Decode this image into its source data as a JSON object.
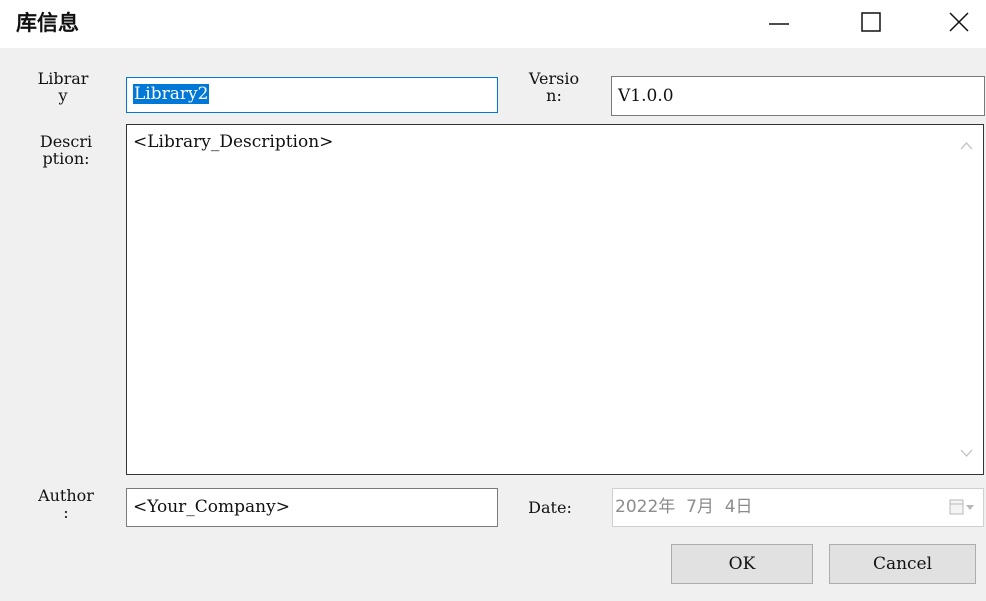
{
  "window": {
    "title": "库信息",
    "minimize_icon": "minimize-icon",
    "maximize_icon": "maximize-icon",
    "close_icon": "close-icon"
  },
  "form": {
    "library_label": "Librar\ny",
    "library_value": "Library2",
    "version_label": "Versio\nn:",
    "version_value": "V1.0.0",
    "description_label": "Descri\nption:",
    "description_value": "<Library_Description>",
    "author_label": "Author\n:",
    "author_value": "<Your_Company>",
    "date_label": "Date:",
    "date_value": "2022年  7月  4日"
  },
  "buttons": {
    "ok": "OK",
    "cancel": "Cancel"
  },
  "colors": {
    "accent": "#0078d7",
    "dialog_bg": "#f0f0f0"
  }
}
